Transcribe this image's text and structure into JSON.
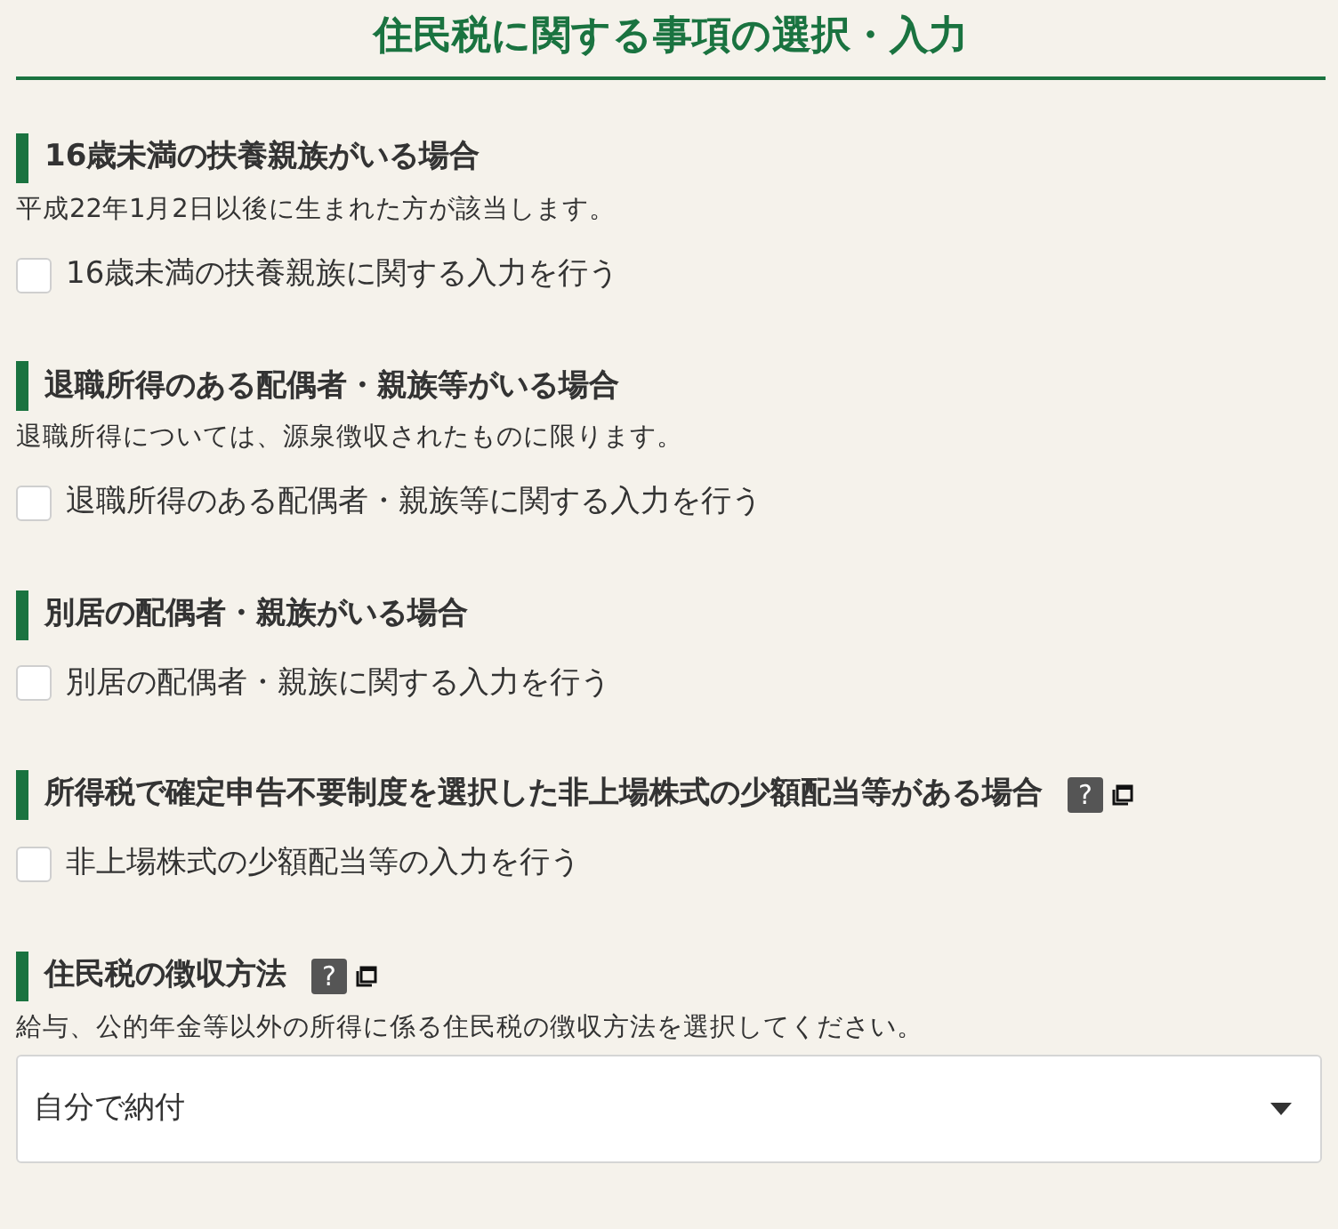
{
  "title": "住民税に関する事項の選択・入力",
  "sections": [
    {
      "heading": "16歳未満の扶養親族がいる場合",
      "note": "平成22年1月2日以後に生まれた方が該当します。",
      "kind": "checkbox",
      "label": "16歳未満の扶養親族に関する入力を行う",
      "checked": false
    },
    {
      "heading": "退職所得のある配偶者・親族等がいる場合",
      "note": "退職所得については、源泉徴収されたものに限ります。",
      "kind": "checkbox",
      "label": "退職所得のある配偶者・親族等に関する入力を行う",
      "checked": false
    },
    {
      "heading": "別居の配偶者・親族がいる場合",
      "kind": "checkbox",
      "label": "別居の配偶者・親族に関する入力を行う",
      "checked": false
    },
    {
      "heading": "所得税で確定申告不要制度を選択した非上場株式の少額配当等がある場合",
      "help_label": "?",
      "kind": "checkbox",
      "label": "非上場株式の少額配当等の入力を行う",
      "checked": false
    },
    {
      "heading": "住民税の徴収方法",
      "help_label": "?",
      "note": "給与、公的年金等以外の所得に係る住民税の徴収方法を選択してください。",
      "kind": "select",
      "value": "自分で納付"
    }
  ]
}
